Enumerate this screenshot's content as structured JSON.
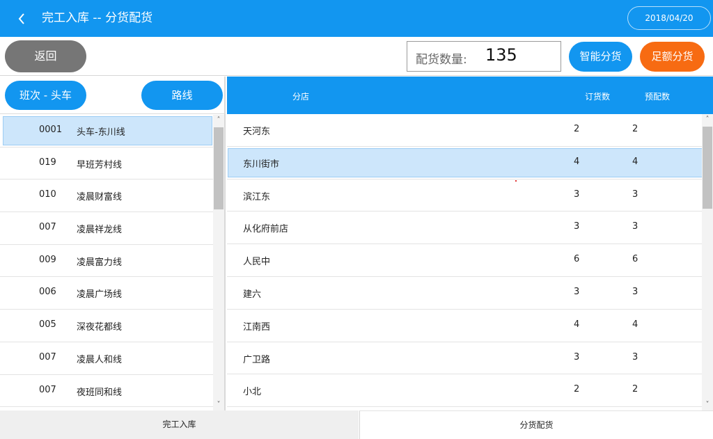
{
  "header": {
    "title": "完工入库 -- 分货配货",
    "date": "2018/04/20"
  },
  "toolbar": {
    "return_label": "返回",
    "qty_label": "配货数量:",
    "qty_value": "135",
    "smart_label": "智能分货",
    "full_label": "足额分货"
  },
  "left": {
    "shift_label": "班次 - 头车",
    "route_label": "路线",
    "routes": [
      {
        "code": "0001",
        "name": "头车-东川线"
      },
      {
        "code": "019",
        "name": "早班芳村线"
      },
      {
        "code": "010",
        "name": "凌晨财富线"
      },
      {
        "code": "007",
        "name": "凌晨祥龙线"
      },
      {
        "code": "009",
        "name": "凌晨富力线"
      },
      {
        "code": "006",
        "name": "凌晨广场线"
      },
      {
        "code": "005",
        "name": "深夜花都线"
      },
      {
        "code": "007",
        "name": "凌晨人和线"
      },
      {
        "code": "007",
        "name": "夜班同和线"
      }
    ]
  },
  "right": {
    "col_store": "分店",
    "col_order": "订货数",
    "col_pre": "预配数",
    "rows": [
      {
        "store": "天河东",
        "order": "2",
        "pre": "2"
      },
      {
        "store": "东川街市",
        "order": "4",
        "pre": "4"
      },
      {
        "store": "滨江东",
        "order": "3",
        "pre": "3"
      },
      {
        "store": "从化府前店",
        "order": "3",
        "pre": "3"
      },
      {
        "store": "人民中",
        "order": "6",
        "pre": "6"
      },
      {
        "store": "建六",
        "order": "3",
        "pre": "3"
      },
      {
        "store": "江南西",
        "order": "4",
        "pre": "4"
      },
      {
        "store": "广卫路",
        "order": "3",
        "pre": "3"
      },
      {
        "store": "小北",
        "order": "2",
        "pre": "2"
      }
    ]
  },
  "tabs": {
    "tab1": "完工入库",
    "tab2": "分货配货"
  },
  "colors": {
    "primary": "#1296f0",
    "orange": "#f76b12",
    "gray_button": "#767676",
    "selected_row": "#cde6fb"
  },
  "icons": {
    "back": "chevron-left-icon",
    "scroll_up": "chevron-up-icon",
    "scroll_down": "chevron-down-icon"
  }
}
